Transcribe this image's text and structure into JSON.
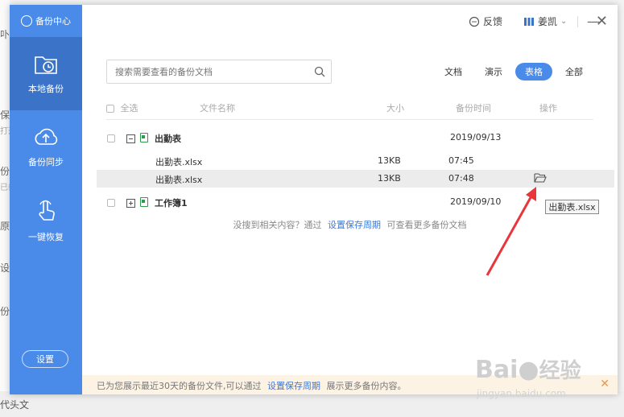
{
  "background_fragments": [
    "卟双",
    "保存",
    "打开",
    "份同",
    "已备",
    "原双",
    "设置",
    "份中",
    "代头文"
  ],
  "sidebar": {
    "brand": "备份中心",
    "items": [
      {
        "label": "本地备份",
        "icon": "folder-clock-icon",
        "active": true
      },
      {
        "label": "备份同步",
        "icon": "cloud-upload-icon",
        "active": false
      },
      {
        "label": "一键恢复",
        "icon": "touch-hand-icon",
        "active": false
      }
    ],
    "settings_label": "设置"
  },
  "titlebar": {
    "feedback": "反馈",
    "user": "姜凯"
  },
  "search": {
    "placeholder": "搜索需要查看的备份文档"
  },
  "filters": [
    {
      "label": "文档",
      "active": false
    },
    {
      "label": "演示",
      "active": false
    },
    {
      "label": "表格",
      "active": true
    },
    {
      "label": "全部",
      "active": false
    }
  ],
  "table": {
    "headers": {
      "select_all": "全选",
      "name": "文件名称",
      "size": "大小",
      "time": "备份时间",
      "action": "操作"
    },
    "groups": [
      {
        "name": "出勤表",
        "date": "2019/09/13",
        "expanded": true,
        "files": [
          {
            "name": "出勤表.xlsx",
            "size": "13KB",
            "time": "07:45"
          },
          {
            "name": "出勤表.xlsx",
            "size": "13KB",
            "time": "07:48"
          }
        ]
      },
      {
        "name": "工作簿1",
        "date": "2019/09/10",
        "expanded": false,
        "files": []
      }
    ]
  },
  "hint": {
    "prefix": "没搜到相关内容？通过",
    "link": "设置保存周期",
    "suffix": "可查看更多备份文档"
  },
  "footer": {
    "prefix": "已为您展示最近30天的备份文件,可以通过",
    "link": "设置保存周期",
    "suffix": "展示更多备份内容。"
  },
  "tooltip": "出勤表.xlsx",
  "watermark": "Bai",
  "watermark_suffix": "经验",
  "watermark_url": "jingyan.baidu.com",
  "colors": {
    "accent": "#4a8bea",
    "sidebar_active": "#3a73c8",
    "arrow": "#e8363a",
    "footer_bg": "#fdf3e4"
  }
}
